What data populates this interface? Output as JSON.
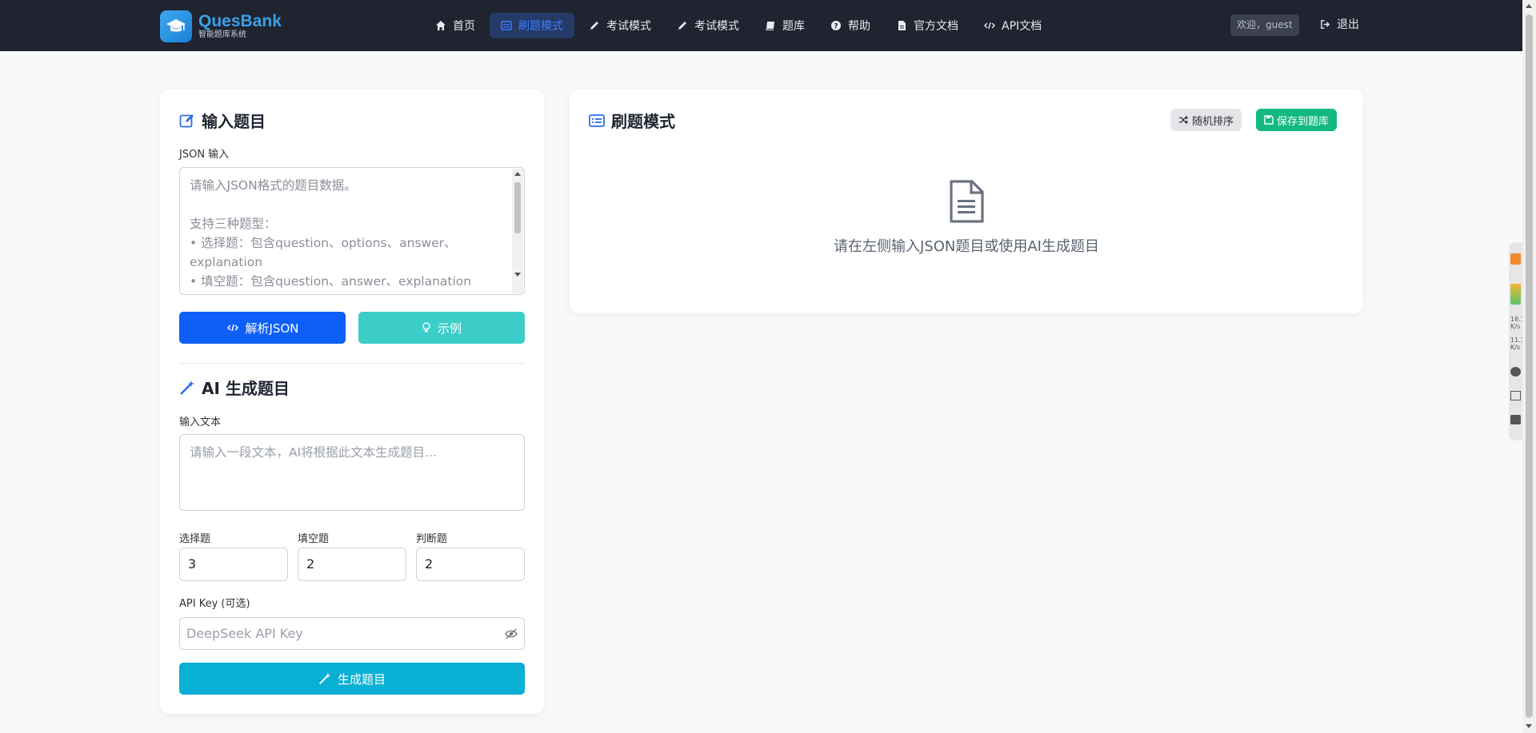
{
  "brand": {
    "name": "QuesBank",
    "subtitle": "智能题库系统"
  },
  "nav": {
    "items": [
      {
        "label": "首页",
        "icon": "home-icon"
      },
      {
        "label": "刷题模式",
        "icon": "list-icon",
        "active": true
      },
      {
        "label": "考试模式",
        "icon": "pencil-icon"
      },
      {
        "label": "考试模式",
        "icon": "pencil-icon"
      },
      {
        "label": "题库",
        "icon": "book-icon"
      },
      {
        "label": "帮助",
        "icon": "question-icon"
      },
      {
        "label": "官方文档",
        "icon": "file-icon"
      },
      {
        "label": "API文档",
        "icon": "code-icon"
      }
    ],
    "welcome": "欢迎，guest",
    "logout": "退出"
  },
  "input_panel": {
    "title": "输入题目",
    "json_label": "JSON 输入",
    "json_placeholder": "请输入JSON格式的题目数据。\n\n支持三种题型：\n• 选择题：包含question、options、answer、explanation\n• 填空题：包含question、answer、explanation",
    "parse_button": "解析JSON",
    "example_button": "示例"
  },
  "ai_panel": {
    "title": "AI 生成题目",
    "text_label": "输入文本",
    "text_placeholder": "请输入一段文本，AI将根据此文本生成题目...",
    "choice_label": "选择题",
    "choice_value": "3",
    "fill_label": "填空题",
    "fill_value": "2",
    "judge_label": "判断题",
    "judge_value": "2",
    "key_label": "API Key (可选)",
    "key_placeholder": "DeepSeek API Key",
    "generate_button": "生成题目"
  },
  "practice_panel": {
    "title": "刷题模式",
    "shuffle_button": "随机排序",
    "save_button": "保存到题库",
    "empty_text": "请在左侧输入JSON题目或使用AI生成题目"
  },
  "side_widget": {
    "up_speed": "18.1",
    "down_speed": "11.7",
    "unit": "K/s"
  },
  "colors": {
    "primary": "#0d5ff8",
    "info": "#3dcdc9",
    "success": "#13b981",
    "cyan": "#0ab0d4",
    "navbar": "#1f2430"
  }
}
